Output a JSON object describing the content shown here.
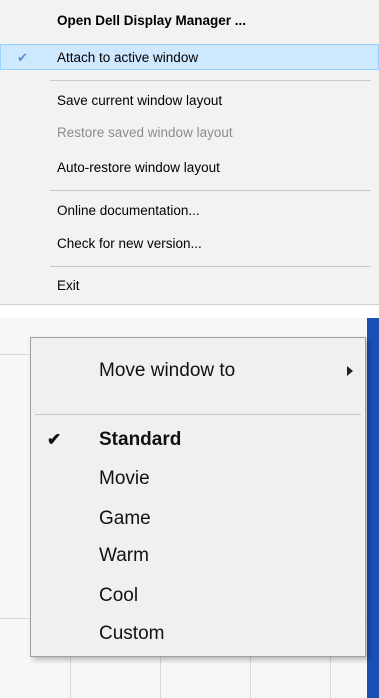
{
  "top_menu": {
    "items": [
      {
        "label": "Open Dell Display Manager ...",
        "checked": false,
        "highlighted": false,
        "disabled": false,
        "bold": true
      },
      {
        "label": "Attach to active window",
        "checked": true,
        "highlighted": true,
        "disabled": false,
        "bold": false
      },
      {
        "label": "Save current window layout",
        "checked": false,
        "highlighted": false,
        "disabled": false,
        "bold": false
      },
      {
        "label": "Restore saved window layout",
        "checked": false,
        "highlighted": false,
        "disabled": true,
        "bold": false
      },
      {
        "label": "Auto-restore window layout",
        "checked": false,
        "highlighted": false,
        "disabled": false,
        "bold": false
      },
      {
        "label": "Online documentation...",
        "checked": false,
        "highlighted": false,
        "disabled": false,
        "bold": false
      },
      {
        "label": "Check for new version...",
        "checked": false,
        "highlighted": false,
        "disabled": false,
        "bold": false
      },
      {
        "label": "Exit",
        "checked": false,
        "highlighted": false,
        "disabled": false,
        "bold": false
      }
    ],
    "check_glyph": "✔",
    "colors": {
      "highlight": "#cde8ff",
      "highlight_border": "#99d1ff",
      "disabled_text": "#8c8c8c"
    }
  },
  "window": {
    "minimize_glyph": "–",
    "maximize_glyph": "□",
    "close_glyph": "✕",
    "accent_color": "#1a4fb4"
  },
  "popup_menu": {
    "submenu": {
      "label": "Move window to",
      "has_arrow": true
    },
    "presets": [
      {
        "label": "Standard",
        "checked": true,
        "bold": true
      },
      {
        "label": "Movie",
        "checked": false,
        "bold": false
      },
      {
        "label": "Game",
        "checked": false,
        "bold": false
      },
      {
        "label": "Warm",
        "checked": false,
        "bold": false
      },
      {
        "label": "Cool",
        "checked": false,
        "bold": false
      },
      {
        "label": "Custom",
        "checked": false,
        "bold": false
      }
    ],
    "check_glyph": "✔"
  }
}
